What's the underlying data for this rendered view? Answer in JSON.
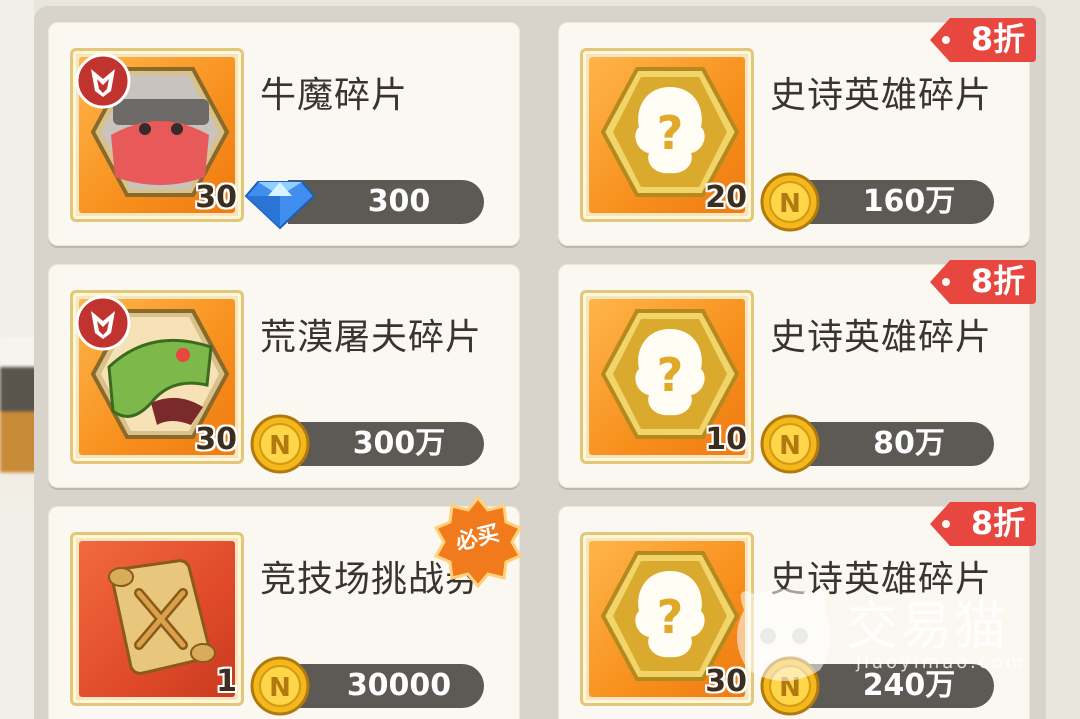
{
  "shop": {
    "items": [
      {
        "name": "牛魔碎片",
        "count": "30",
        "price": "300",
        "currency_icon": "diamond-icon",
        "discount": "",
        "badge": "",
        "thumb": "bull-demon-hero"
      },
      {
        "name": "史诗英雄碎片",
        "count": "20",
        "price": "160万",
        "currency_icon": "gold-coin-icon",
        "discount": "8折",
        "badge": "",
        "thumb": "mystery-hero"
      },
      {
        "name": "荒漠屠夫碎片",
        "count": "30",
        "price": "300万",
        "currency_icon": "gold-coin-icon",
        "discount": "",
        "badge": "",
        "thumb": "desert-butcher-hero"
      },
      {
        "name": "史诗英雄碎片",
        "count": "10",
        "price": "80万",
        "currency_icon": "gold-coin-icon",
        "discount": "8折",
        "badge": "",
        "thumb": "mystery-hero"
      },
      {
        "name": "竞技场挑战券",
        "count": "1",
        "price": "30000",
        "currency_icon": "gold-coin-icon",
        "discount": "",
        "badge": "必买",
        "thumb": "arena-ticket"
      },
      {
        "name": "史诗英雄碎片",
        "count": "30",
        "price": "240万",
        "currency_icon": "gold-coin-icon",
        "discount": "8折",
        "badge": "",
        "thumb": "mystery-hero"
      }
    ]
  },
  "watermark": {
    "text": "交易猫",
    "subtext": "jiaoyimao.com"
  },
  "colors": {
    "discount_red": "#e8473f",
    "price_bar": "#5d5955",
    "thumb_orange": "#f78f1c",
    "coin_gold": "#f4b81c"
  }
}
